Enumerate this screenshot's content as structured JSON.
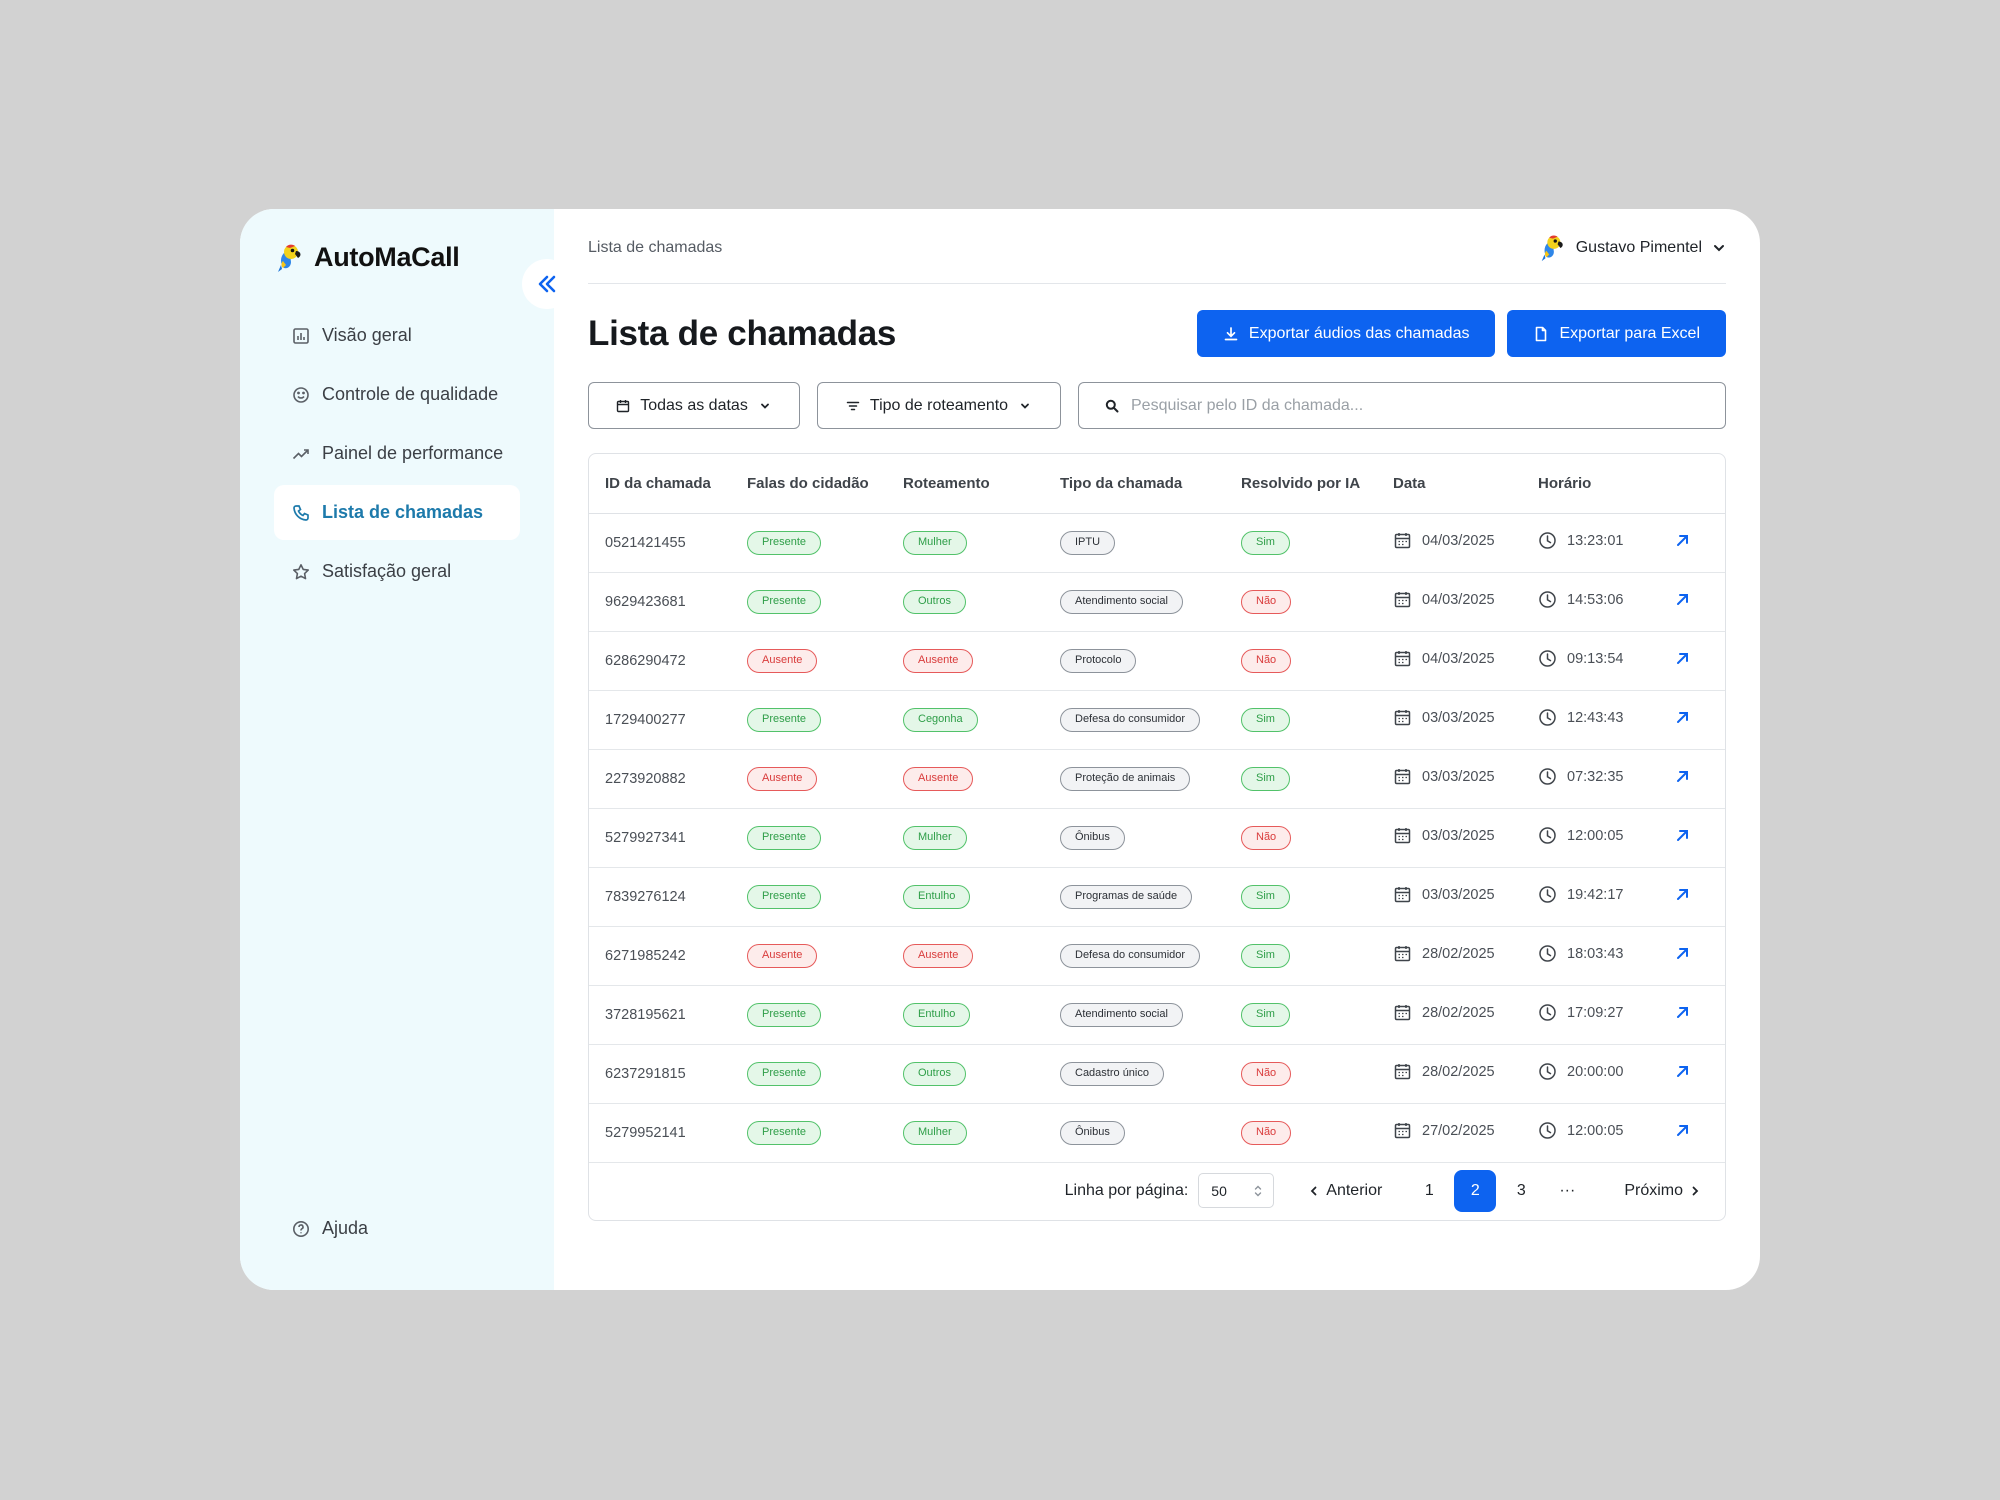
{
  "brand": {
    "name": "AutoMaCall"
  },
  "sidebar": {
    "items": [
      {
        "label": "Visão geral",
        "icon": "chart-icon",
        "active": false
      },
      {
        "label": "Controle de qualidade",
        "icon": "smile-icon",
        "active": false
      },
      {
        "label": "Painel de performance",
        "icon": "trend-icon",
        "active": false
      },
      {
        "label": "Lista de chamadas",
        "icon": "phone-icon",
        "active": true
      },
      {
        "label": "Satisfação geral",
        "icon": "star-icon",
        "active": false
      }
    ],
    "help_label": "Ajuda"
  },
  "header": {
    "breadcrumb": "Lista de chamadas",
    "user_name": "Gustavo Pimentel"
  },
  "page": {
    "title": "Lista de chamadas",
    "export_audio_label": "Exportar áudios das chamadas",
    "export_excel_label": "Exportar para Excel"
  },
  "filters": {
    "dates_label": "Todas as datas",
    "routing_label": "Tipo de roteamento",
    "search_placeholder": "Pesquisar pelo ID da chamada..."
  },
  "table": {
    "columns": [
      "ID da chamada",
      "Falas do cidadão",
      "Roteamento",
      "Tipo da chamada",
      "Resolvido por IA",
      "Data",
      "Horário"
    ],
    "rows": [
      {
        "id": "0521421455",
        "falas": "Presente",
        "roteamento": "Mulher",
        "tipo": "IPTU",
        "resolvido": "Sim",
        "data": "04/03/2025",
        "horario": "13:23:01"
      },
      {
        "id": "9629423681",
        "falas": "Presente",
        "roteamento": "Outros",
        "tipo": "Atendimento social",
        "resolvido": "Não",
        "data": "04/03/2025",
        "horario": "14:53:06"
      },
      {
        "id": "6286290472",
        "falas": "Ausente",
        "roteamento": "Ausente",
        "tipo": "Protocolo",
        "resolvido": "Não",
        "data": "04/03/2025",
        "horario": "09:13:54"
      },
      {
        "id": "1729400277",
        "falas": "Presente",
        "roteamento": "Cegonha",
        "tipo": "Defesa do consumidor",
        "resolvido": "Sim",
        "data": "03/03/2025",
        "horario": "12:43:43"
      },
      {
        "id": "2273920882",
        "falas": "Ausente",
        "roteamento": "Ausente",
        "tipo": "Proteção de animais",
        "resolvido": "Sim",
        "data": "03/03/2025",
        "horario": "07:32:35"
      },
      {
        "id": "5279927341",
        "falas": "Presente",
        "roteamento": "Mulher",
        "tipo": "Ônibus",
        "resolvido": "Não",
        "data": "03/03/2025",
        "horario": "12:00:05"
      },
      {
        "id": "7839276124",
        "falas": "Presente",
        "roteamento": "Entulho",
        "tipo": "Programas de saúde",
        "resolvido": "Sim",
        "data": "03/03/2025",
        "horario": "19:42:17"
      },
      {
        "id": "6271985242",
        "falas": "Ausente",
        "roteamento": "Ausente",
        "tipo": "Defesa do consumidor",
        "resolvido": "Sim",
        "data": "28/02/2025",
        "horario": "18:03:43"
      },
      {
        "id": "3728195621",
        "falas": "Presente",
        "roteamento": "Entulho",
        "tipo": "Atendimento social",
        "resolvido": "Sim",
        "data": "28/02/2025",
        "horario": "17:09:27"
      },
      {
        "id": "6237291815",
        "falas": "Presente",
        "roteamento": "Outros",
        "tipo": "Cadastro único",
        "resolvido": "Não",
        "data": "28/02/2025",
        "horario": "20:00:00"
      },
      {
        "id": "5279952141",
        "falas": "Presente",
        "roteamento": "Mulher",
        "tipo": "Ônibus",
        "resolvido": "Não",
        "data": "27/02/2025",
        "horario": "12:00:05"
      }
    ]
  },
  "pagination": {
    "rows_label": "Linha por página:",
    "rows_value": "50",
    "prev_label": "Anterior",
    "next_label": "Próximo",
    "pages": [
      "1",
      "2",
      "3"
    ],
    "current": "2",
    "ellipsis": "···"
  },
  "colors": {
    "accent": "#0d63f0",
    "sidebar_bg": "#eefafd",
    "active_nav": "#1d7aab",
    "green": "#52c26a",
    "red": "#e65a5a"
  }
}
